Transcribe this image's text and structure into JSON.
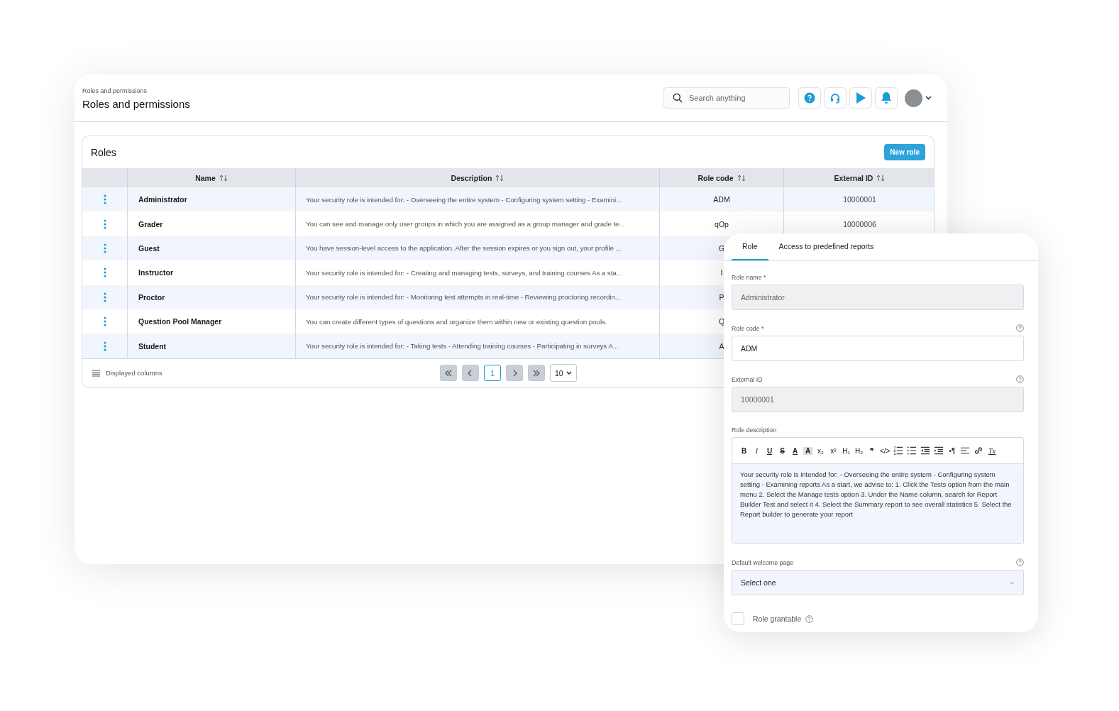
{
  "header": {
    "breadcrumb": "Roles and permissions",
    "title": "Roles and permissions",
    "search": {
      "placeholder": "Search anything"
    }
  },
  "roles_card": {
    "title": "Roles",
    "new_button": "New role",
    "columns": [
      {
        "label": "Name"
      },
      {
        "label": "Description"
      },
      {
        "label": "Role code"
      },
      {
        "label": "External ID"
      }
    ],
    "rows": [
      {
        "name": "Administrator",
        "description": "Your security role is intended for: - Overseeing the entire system - Configuring system setting - Examini...",
        "code": "ADM",
        "external_id": "10000001"
      },
      {
        "name": "Grader",
        "description": "You can see and manage only user groups in which you are assigned as a group manager and grade te...",
        "code": "qOp",
        "external_id": "10000006"
      },
      {
        "name": "Guest",
        "description": "You have session-level access to the application. After the session expires or you sign out, your profile ...",
        "code": "G"
      },
      {
        "name": "Instructor",
        "description": "Your security role is intended for: - Creating and managing tests, surveys, and training courses As a sta...",
        "code": "I"
      },
      {
        "name": "Proctor",
        "description": "Your security role is intended for: - Monitoring test attempts in real-time - Reviewing proctoring recordin...",
        "code": "P"
      },
      {
        "name": "Question Pool Manager",
        "description": "You can create different types of questions and organize them within new or existing question pools.",
        "code": "Q"
      },
      {
        "name": "Student",
        "description": "Your security role is intended for: - Taking tests - Attending training courses - Participating in surveys A...",
        "code": "A"
      }
    ],
    "footer": {
      "columns_button": "Displayed columns",
      "pages": [
        {
          "label": "1",
          "selected": true
        }
      ],
      "page_size": "10"
    }
  },
  "panel": {
    "tabs": [
      {
        "label": "Role",
        "selected": true
      },
      {
        "label": "Access to predefined reports",
        "selected": false
      }
    ],
    "fields": [
      {
        "label": "Role name *",
        "value": "Administrator",
        "disabled": true,
        "help": false
      },
      {
        "label": "Role code *",
        "value": "ADM",
        "disabled": false,
        "help": true
      },
      {
        "label": "External ID",
        "value": "10000001",
        "disabled": true,
        "help": true
      }
    ],
    "description": {
      "label": "Role description",
      "toolbar": [
        {
          "kind": "bold",
          "label": "B"
        },
        {
          "kind": "italic",
          "label": "I"
        },
        {
          "kind": "underline",
          "label": "U"
        },
        {
          "kind": "strike",
          "label": "S"
        },
        {
          "kind": "color",
          "label": "A"
        },
        {
          "kind": "highlight",
          "label": "A"
        },
        {
          "kind": "plain",
          "label": "x₂"
        },
        {
          "kind": "plain",
          "label": "x²"
        },
        {
          "kind": "plain",
          "label": "H₁"
        },
        {
          "kind": "plain",
          "label": "H₂"
        },
        {
          "kind": "bold",
          "label": "❞"
        },
        {
          "kind": "plain",
          "label": "</>"
        },
        {
          "kind": "ordered-list"
        },
        {
          "kind": "bullet-list"
        },
        {
          "kind": "outdent"
        },
        {
          "kind": "indent"
        },
        {
          "kind": "plain",
          "label": "•¶"
        },
        {
          "kind": "align"
        },
        {
          "kind": "link"
        },
        {
          "kind": "clear",
          "label": "Tx"
        }
      ],
      "text": "Your security role is intended for: - Overseeing the entire system - Configuring system setting - Examining reports As a start, we advise to: 1. Click the Tests option from the main menu 2. Select the Manage tests option 3. Under the Name column, search for Report Builder Test and select it 4. Select the Summary report to see overall statistics 5. Select the Report builder to generate your report"
    },
    "welcome": {
      "label": "Default welcome page",
      "value": "Select one",
      "help": true
    },
    "grantable": {
      "label": "Role grantable",
      "checked": false,
      "help": true
    }
  }
}
